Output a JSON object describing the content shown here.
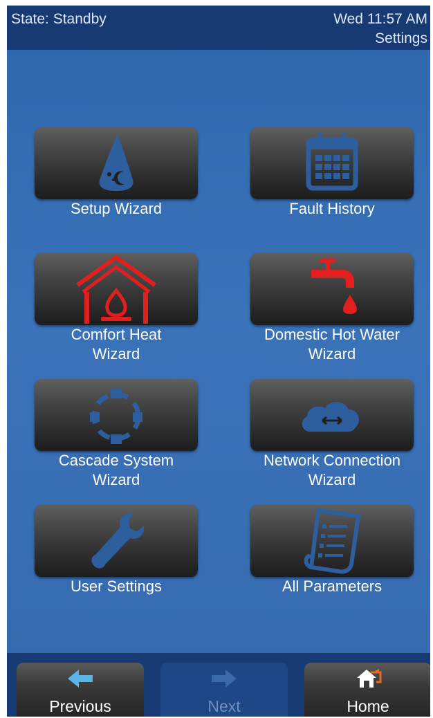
{
  "header": {
    "state": "State: Standby",
    "datetime": "Wed 11:57 AM",
    "page": "Settings"
  },
  "tiles": [
    {
      "label_lines": [
        "Setup Wizard"
      ],
      "icon": "wizard-hat-icon",
      "color": "#2d5f9e"
    },
    {
      "label_lines": [
        "Fault History"
      ],
      "icon": "calendar-icon",
      "color": "#2d5f9e"
    },
    {
      "label_lines": [
        "Comfort Heat",
        "Wizard"
      ],
      "icon": "house-flame-icon",
      "color": "#e21f1f"
    },
    {
      "label_lines": [
        "Domestic Hot Water",
        "Wizard"
      ],
      "icon": "faucet-icon",
      "color": "#e21f1f"
    },
    {
      "label_lines": [
        "Cascade System",
        "Wizard"
      ],
      "icon": "cascade-network-icon",
      "color": "#2d5f9e"
    },
    {
      "label_lines": [
        "Network Connection",
        "Wizard"
      ],
      "icon": "cloud-arrows-icon",
      "color": "#2d5f9e"
    },
    {
      "label_lines": [
        "User Settings"
      ],
      "icon": "wrench-icon",
      "color": "#2d5f9e"
    },
    {
      "label_lines": [
        "All Parameters"
      ],
      "icon": "document-list-icon",
      "color": "#2d5f9e"
    }
  ],
  "footer": {
    "previous": {
      "label": "Previous",
      "icon": "arrow-left-icon",
      "color": "#5ab4e8"
    },
    "next": {
      "label": "Next",
      "icon": "arrow-right-icon",
      "color": "#3a6aa8",
      "disabled": true
    },
    "home": {
      "label": "Home",
      "icon": "home-exit-icon"
    }
  }
}
